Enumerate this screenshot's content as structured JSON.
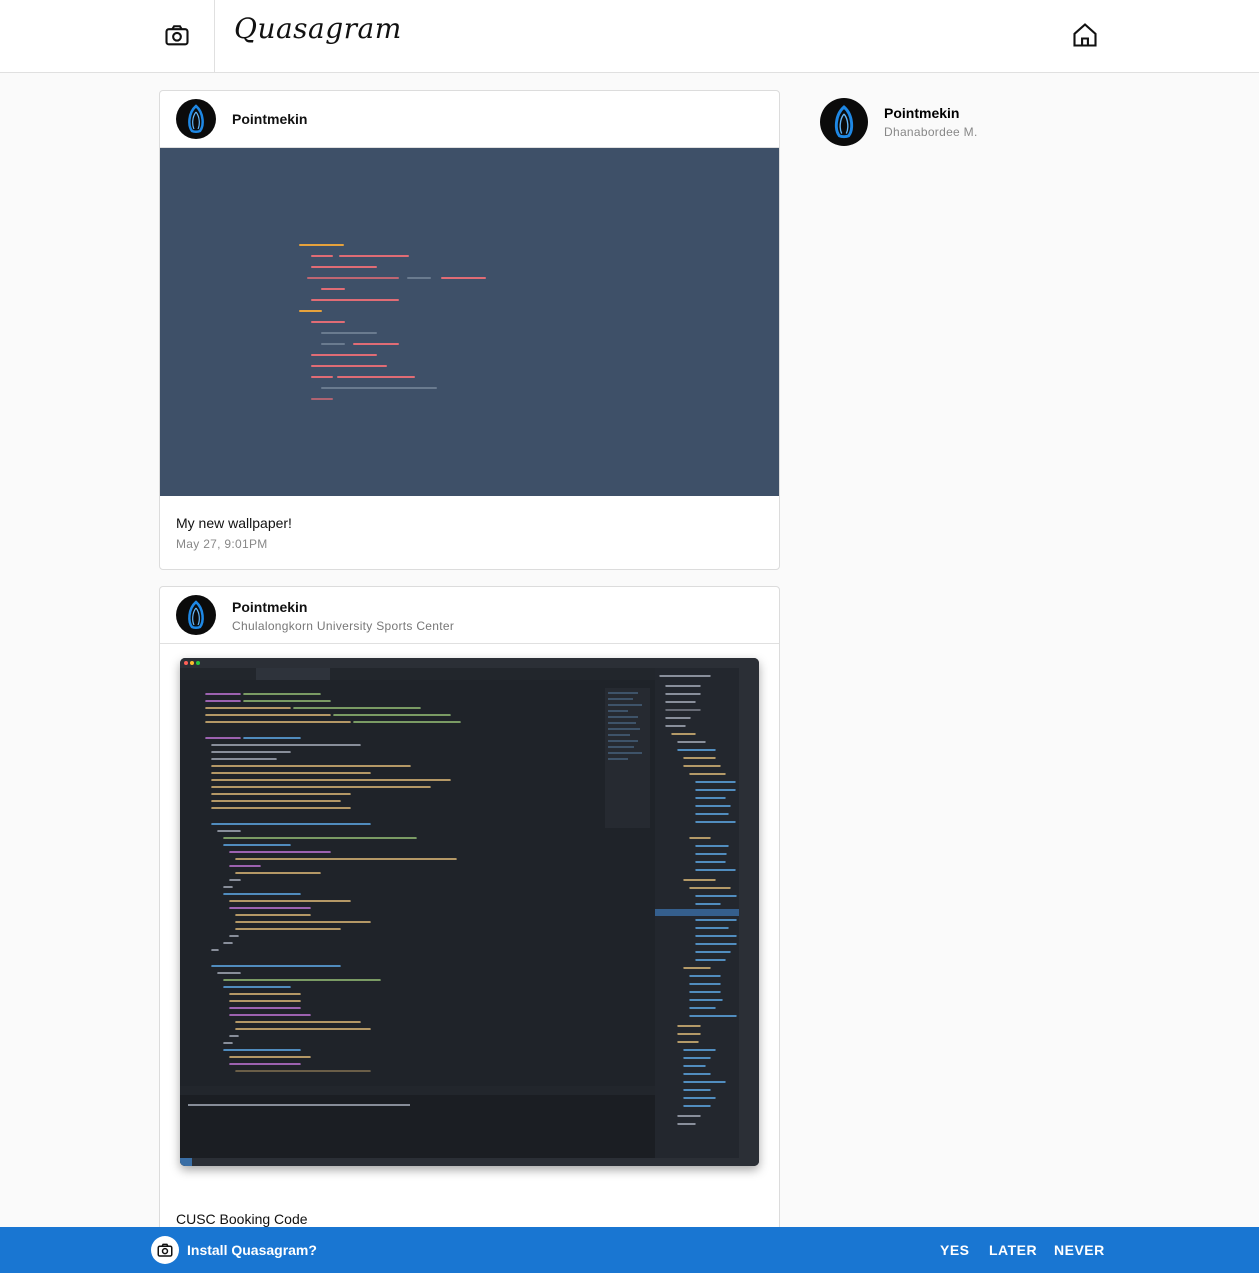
{
  "header": {
    "brand": "Quasagram",
    "camera_icon": "camera-icon",
    "home_icon": "home-icon"
  },
  "posts": [
    {
      "username": "Pointmekin",
      "location": "",
      "image": "code-wallpaper",
      "caption": "My new wallpaper!",
      "timestamp": "May 27, 9:01PM"
    },
    {
      "username": "Pointmekin",
      "location": "Chulalongkorn University Sports Center",
      "image": "vscode-screenshot",
      "caption": "CUSC Booking Code"
    }
  ],
  "sidebar": {
    "username": "Pointmekin",
    "fullname": "Dhanabordee M."
  },
  "install_banner": {
    "text": "Install Quasagram?",
    "yes": "YES",
    "later": "LATER",
    "never": "NEVER"
  },
  "colors": {
    "banner": "#1976d2",
    "wallpaper_bg": "#3e5068",
    "avatar_glow": "#1e88e5"
  }
}
